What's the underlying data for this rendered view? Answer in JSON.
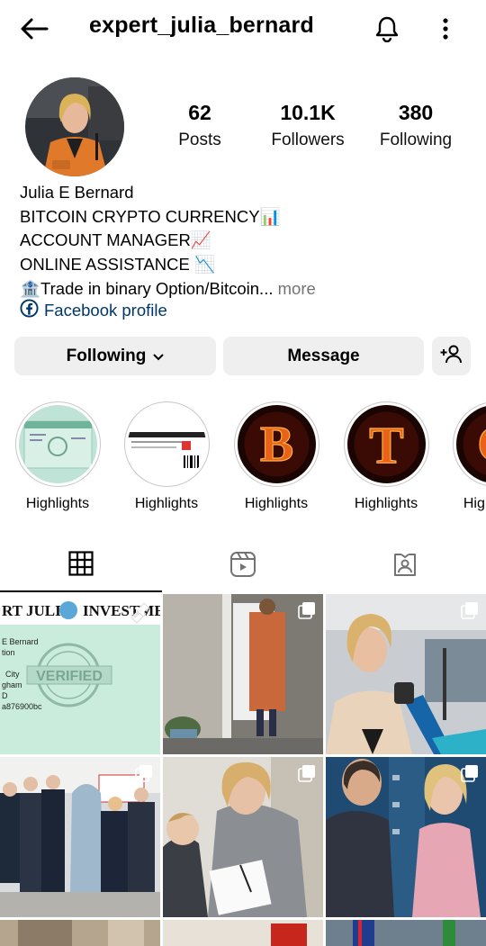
{
  "header": {
    "username": "expert_julia_bernard"
  },
  "profile": {
    "stats": [
      {
        "value": "62",
        "label": "Posts"
      },
      {
        "value": "10.1K",
        "label": "Followers"
      },
      {
        "value": "380",
        "label": "Following"
      }
    ],
    "name": "Julia E Bernard",
    "bio_lines": [
      "BITCOIN CRYPTO CURRENCY📊",
      "ACCOUNT MANAGER📈",
      "ONLINE ASSISTANCE 📉",
      "🏦Trade in binary Option/Bitcoin..."
    ],
    "more_label": "more",
    "link_label": "Facebook profile"
  },
  "actions": {
    "following_label": "Following",
    "message_label": "Message"
  },
  "highlights": [
    {
      "label": "Highlights",
      "letter": ""
    },
    {
      "label": "Highlights",
      "letter": ""
    },
    {
      "label": "Highlights",
      "letter": "B"
    },
    {
      "label": "Highlights",
      "letter": "T"
    },
    {
      "label": "Highlights",
      "letter": "C"
    }
  ],
  "post1": {
    "banner": "RT JULIA",
    "banner2": "INVESTMEN",
    "badge": "VERIFIED",
    "text_lines": [
      "E Bernard",
      "tion",
      "City",
      "gham",
      "D",
      "a876900bc"
    ]
  },
  "colors": {
    "link": "#00376b",
    "button_bg": "#efefef",
    "muted": "#737373"
  }
}
